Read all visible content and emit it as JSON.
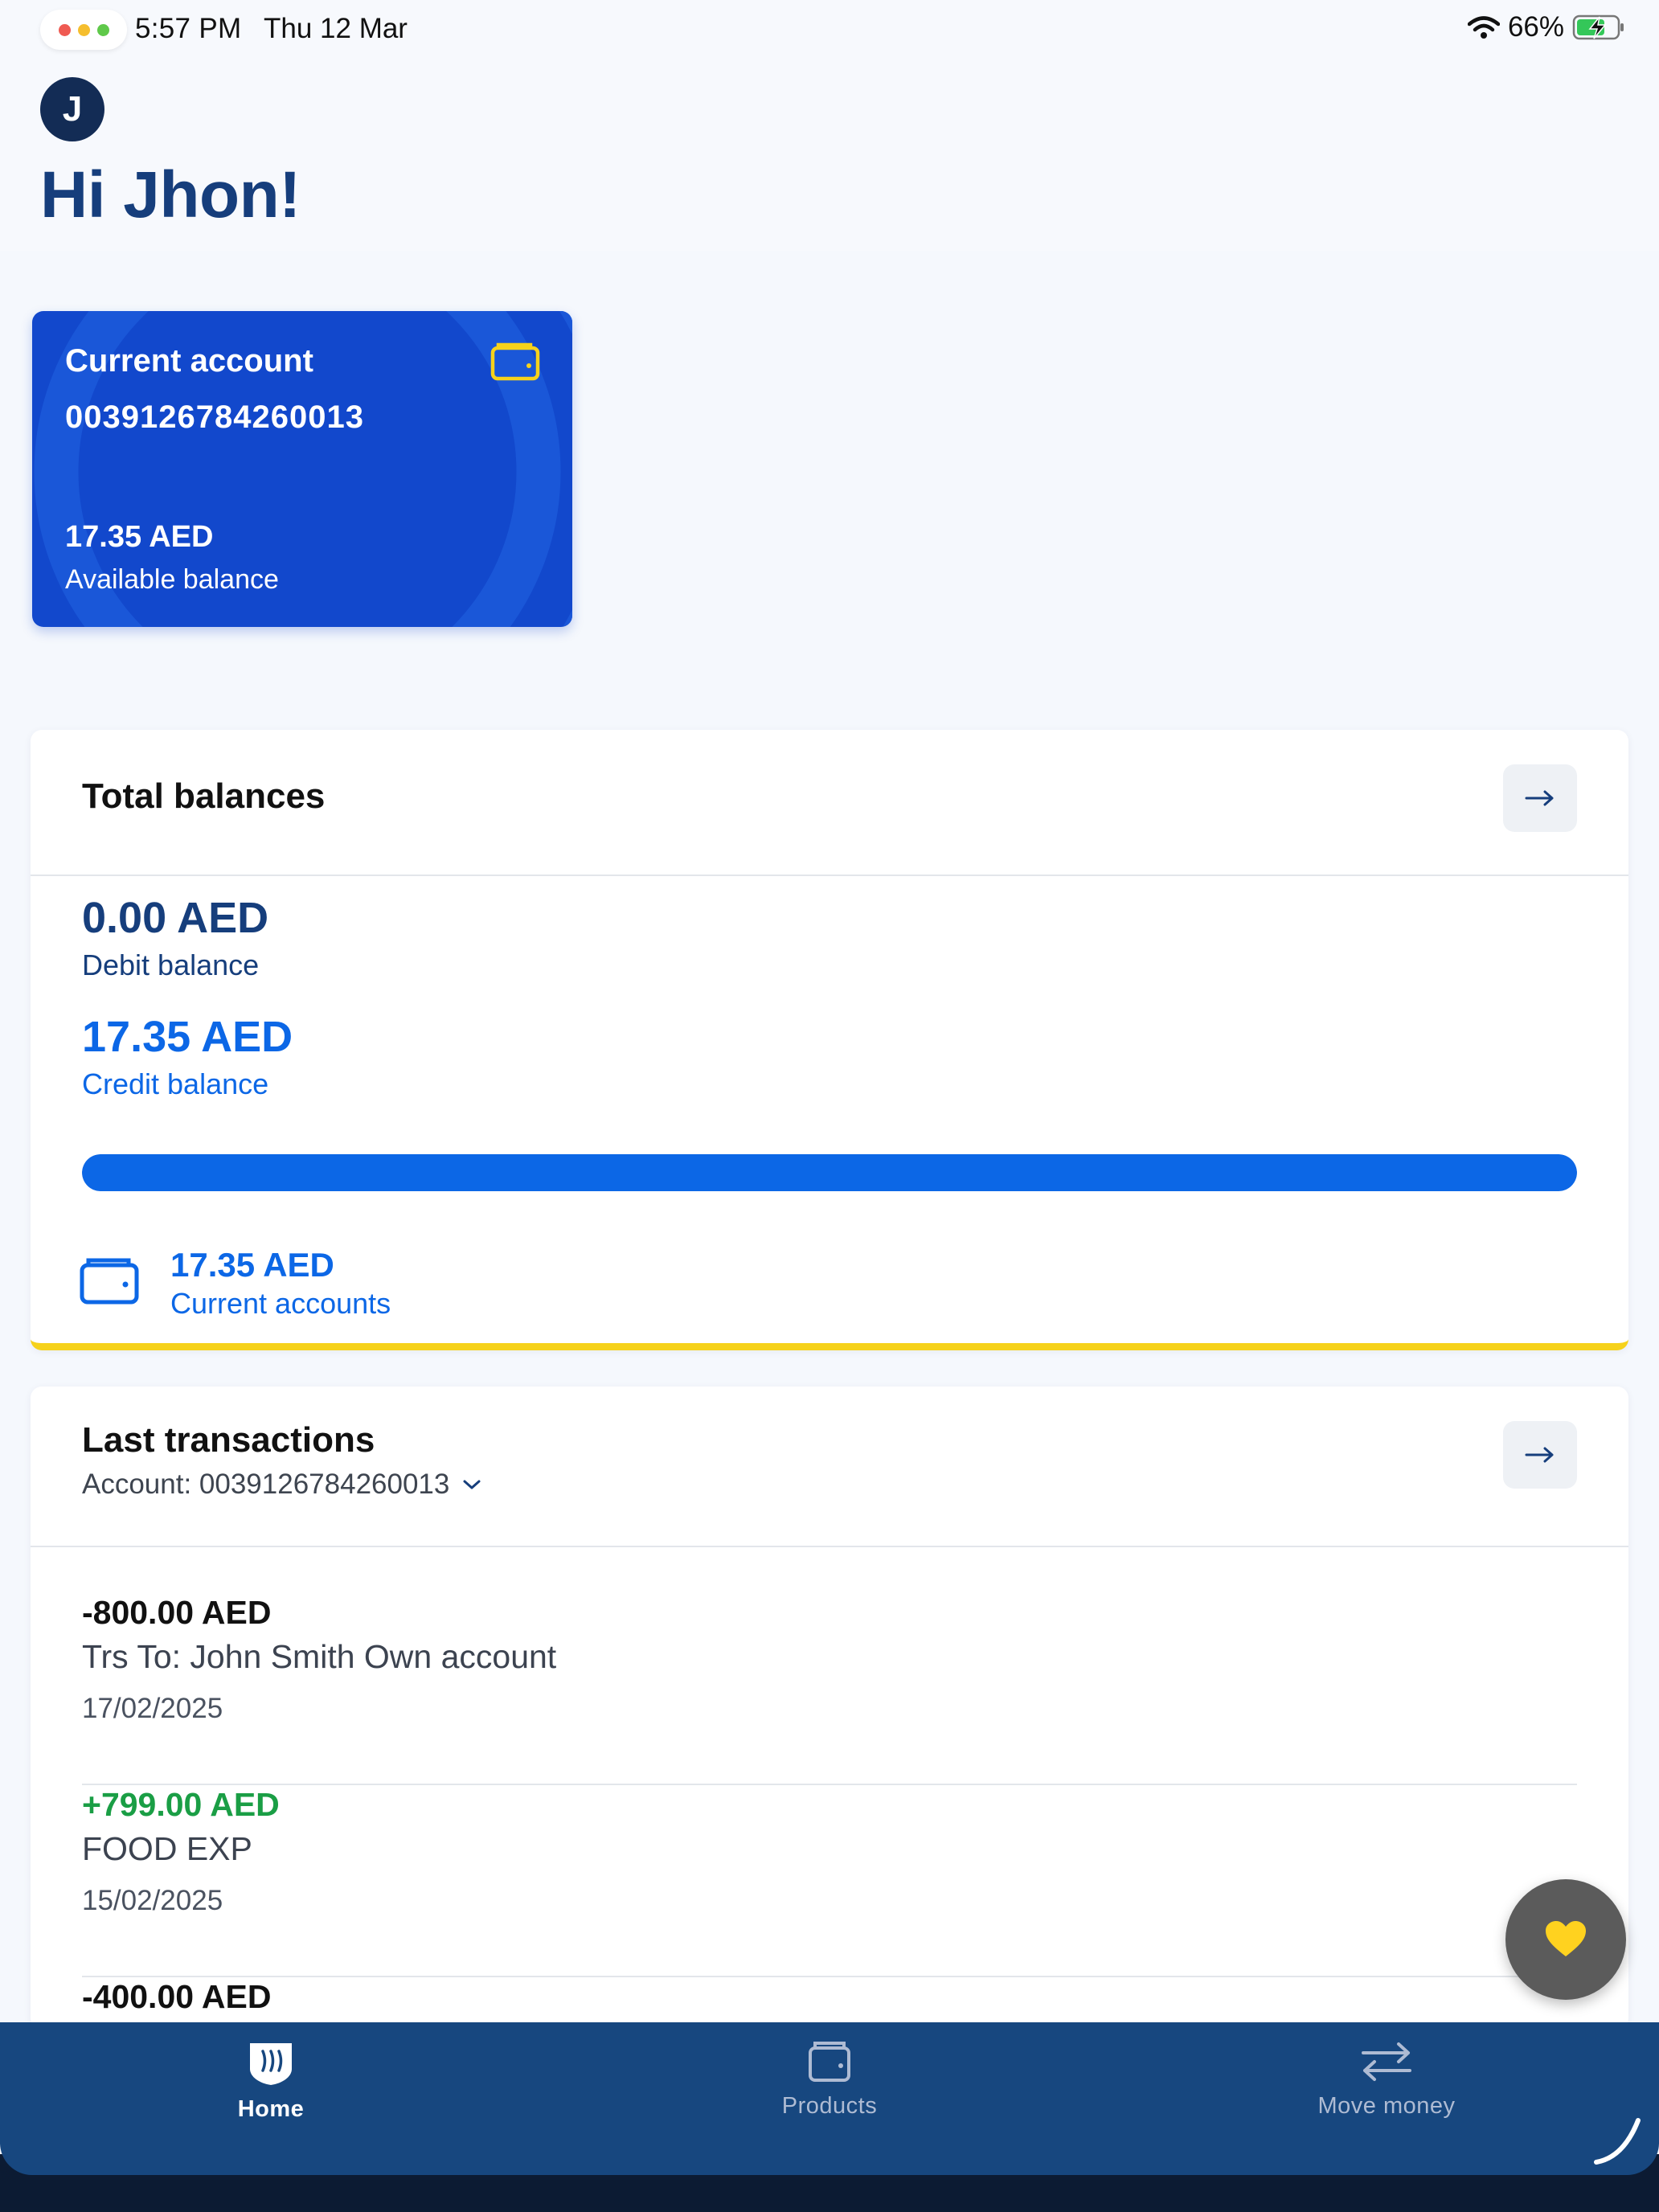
{
  "status_bar": {
    "time": "5:57 PM",
    "date": "Thu 12 Mar",
    "battery_percent": "66%"
  },
  "header": {
    "avatar_initial": "J",
    "greeting": "Hi Jhon!"
  },
  "account_card": {
    "title": "Current account",
    "number": "0039126784260013",
    "amount": "17.35 AED",
    "label": "Available balance",
    "wallet_icon": "wallet-icon",
    "accent_color": "#1248cc"
  },
  "total_balances": {
    "title": "Total balances",
    "debit_amount": "0.00 AED",
    "debit_label": "Debit balance",
    "credit_amount": "17.35 AED",
    "credit_label": "Credit balance",
    "credit_share": 1.0,
    "accounts_amount": "17.35 AED",
    "accounts_label": "Current accounts",
    "highlight_color": "#f6d21b"
  },
  "last_transactions": {
    "title": "Last transactions",
    "account_label": "Account: 0039126784260013",
    "items": [
      {
        "amount": "-800.00 AED",
        "description": "Trs To: John Smith Own account",
        "date": "17/02/2025",
        "color": "#111111"
      },
      {
        "amount": "+799.00 AED",
        "description": "FOOD EXP",
        "date": "15/02/2025",
        "color": "#1a9e45"
      },
      {
        "amount": "-400.00 AED",
        "description": "",
        "date": "",
        "color": "#111111"
      }
    ]
  },
  "bottom_nav": {
    "items": [
      {
        "label": "Home",
        "icon": "home-icon",
        "active": true
      },
      {
        "label": "Products",
        "icon": "wallet-icon",
        "active": false
      },
      {
        "label": "Move money",
        "icon": "transfer-arrows-icon",
        "active": false
      }
    ]
  },
  "fab": {
    "icon": "heart-icon",
    "color": "#ffd21f"
  }
}
